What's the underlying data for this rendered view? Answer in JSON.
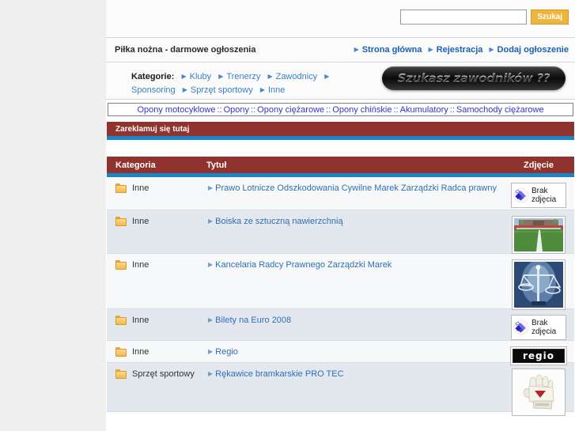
{
  "search": {
    "value": "",
    "placeholder": "",
    "button_label": "Szukaj"
  },
  "header": {
    "site_title": "Piłka nożna - darmowe ogłoszenia",
    "nav": [
      {
        "label": "Strona główna"
      },
      {
        "label": "Rejestracja"
      },
      {
        "label": "Dodaj ogłoszenie"
      }
    ]
  },
  "categories": {
    "label": "Kategorie:",
    "items": [
      {
        "label": "Kluby"
      },
      {
        "label": "Trenerzy"
      },
      {
        "label": "Zawodnicy"
      },
      {
        "label": "Sponsoring"
      },
      {
        "label": "Sprzęt sportowy"
      },
      {
        "label": "Inne"
      }
    ]
  },
  "banner": {
    "text": "Szukasz zawodników ??"
  },
  "partner_links": {
    "separator": "::",
    "items": [
      {
        "label": "Opony motocyklowe"
      },
      {
        "label": "Opony"
      },
      {
        "label": "Opony ciężarowe"
      },
      {
        "label": "Opony chińskie"
      },
      {
        "label": "Akumulatory"
      },
      {
        "label": "Samochody ciężarowe"
      }
    ]
  },
  "advertise_bar": {
    "label": "Zareklamuj się tutaj"
  },
  "listing": {
    "columns": {
      "category": "Kategoria",
      "title": "Tytuł",
      "image": "Zdjęcie"
    },
    "no_photo_label_line1": "Brak",
    "no_photo_label_line2": "zdjęcia",
    "rows": [
      {
        "category": "Inne",
        "title": "Prawo Lotnicze Odszkodowania Cywilne Marek Zarządzki Radca prawny",
        "thumb": "no-photo"
      },
      {
        "category": "Inne",
        "title": "Boiska ze sztuczną nawierzchnią",
        "thumb": "pitch-photo"
      },
      {
        "category": "Inne",
        "title": "Kancelaria Radcy Prawnego Zarządzki Marek",
        "thumb": "scales-photo"
      },
      {
        "category": "Inne",
        "title": "Bilety na Euro 2008",
        "thumb": "no-photo"
      },
      {
        "category": "Inne",
        "title": "Regio",
        "thumb": "regio-logo",
        "logo_text": "regio"
      },
      {
        "category": "Sprzęt sportowy",
        "title": "Rękawice bramkarskie PRO TEC",
        "thumb": "glove-photo"
      }
    ]
  },
  "colors": {
    "accent_red": "#90332f",
    "accent_blue": "#1a85c8",
    "link_blue": "#2e6fb5",
    "button_gold": "#eeb63d"
  }
}
